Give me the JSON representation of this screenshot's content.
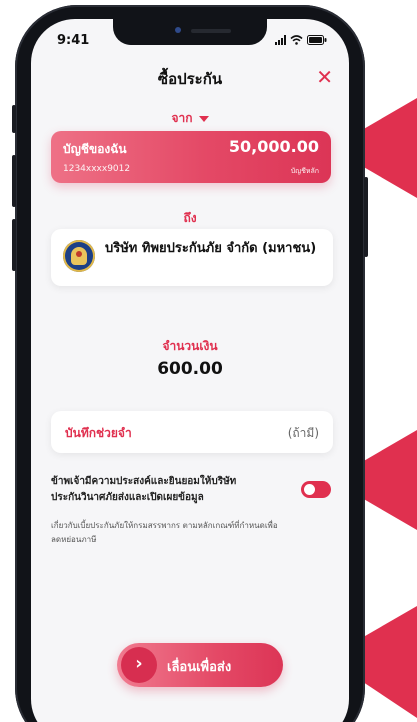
{
  "status": {
    "time": "9:41"
  },
  "header": {
    "title": "ซื้อประกัน",
    "close_icon": "close-icon"
  },
  "from": {
    "label": "จาก",
    "account_name": "บัญชีของฉัน",
    "amount": "50,000.00",
    "account_number": "1234xxxx9012",
    "account_tag": "บัญชีหลัก"
  },
  "to": {
    "label": "ถึง",
    "payee_name": "บริษัท ทิพยประกันภัย จำกัด (มหาชน)"
  },
  "amount": {
    "label": "จำนวนเงิน",
    "value": "600.00"
  },
  "memo": {
    "label": "บันทึกช่วยจำ",
    "optional": "(ถ้ามี)"
  },
  "consent": {
    "text": "ข้าพเจ้ามีความประสงค์และยินยอมให้บริษัท ประกันวินาศภัยส่งและเปิดเผยข้อมูล",
    "subtext": "เกี่ยวกับเบี้ยประกันภัยให้กรมสรรพากร ตามหลักเกณฑ์ที่กำหนดเพื่อลดหย่อนภาษี",
    "toggle_on": true
  },
  "slide": {
    "label": "เลื่อนเพื่อส่ง",
    "handle_glyph": "›"
  },
  "colors": {
    "accent": "#e0304f",
    "card_gradient_start": "#ee7186",
    "card_gradient_end": "#dc3556"
  }
}
